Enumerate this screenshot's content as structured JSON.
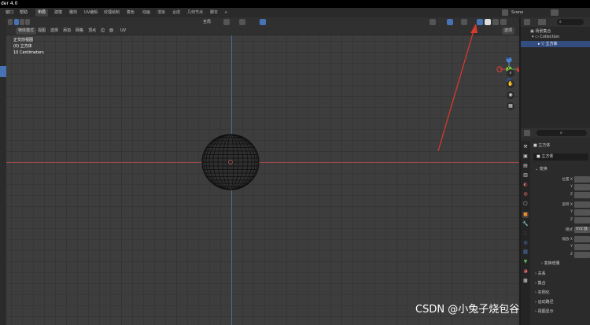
{
  "title_bar": {
    "text": "der 4.0"
  },
  "menu": {
    "items": [
      "窗口",
      "帮助"
    ],
    "workspaces": [
      "布局",
      "建模",
      "雕刻",
      "UV编辑",
      "纹理绘制",
      "着色",
      "动画",
      "渲染",
      "合成",
      "几何节点",
      "脚本"
    ],
    "add_tab": "+",
    "scene_label": "Scene"
  },
  "viewport_header": {
    "mode": "物体模式",
    "menus": [
      "视图",
      "选择",
      "添加",
      "网格",
      "顶点",
      "边",
      "面",
      "UV"
    ],
    "orientation": "全局",
    "options": "选项"
  },
  "viewport_overlay": {
    "line1": "正交前视图",
    "line2": "(0) 立方体",
    "line3": "10 Centimeters"
  },
  "gizmo": {
    "z": "Z",
    "x": "X",
    "y": "Y"
  },
  "outliner": {
    "scene_collection": "场景集合",
    "collection": "Collection",
    "object": "立方体"
  },
  "properties": {
    "object_name": "立方体",
    "object_field": "立方体",
    "transform_section": "变换",
    "location_label": "位置 X",
    "y_label": "Y",
    "z_label": "Z",
    "rotation_label": "旋转 X",
    "mode_label": "模式",
    "mode_value": "XYZ 欧",
    "scale_label": "缩放 X",
    "delta_transform": "变换增量",
    "relations": "关系",
    "collections": "集合",
    "instancing": "实例化",
    "motion_paths": "运动路径",
    "visibility": "视图显示"
  },
  "watermark": "CSDN @小兔子烧包谷",
  "colors": {
    "accent": "#4772b3",
    "arrow": "#d63a2f",
    "axis_x": "#9a4a4a",
    "axis_y": "#4a6d92"
  }
}
